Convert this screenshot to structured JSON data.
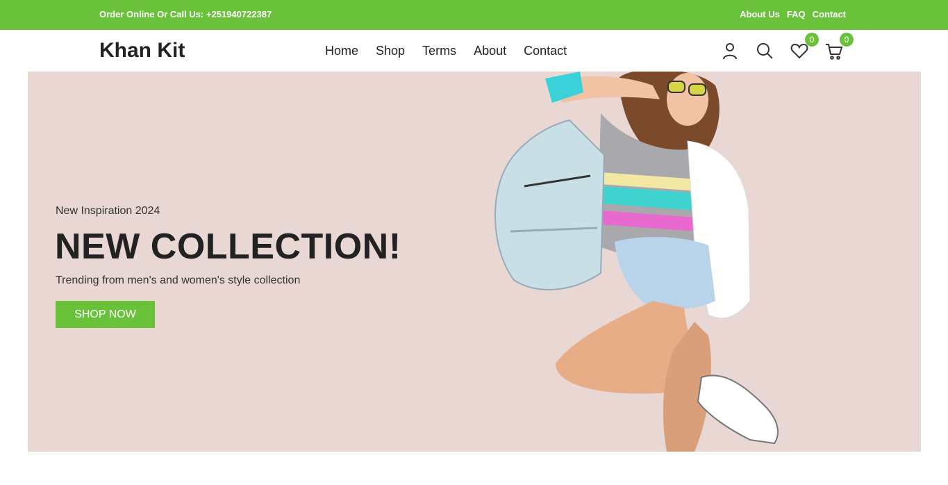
{
  "topbar": {
    "phone_text": "Order Online Or Call Us: +251940722387",
    "links": [
      "About Us",
      "FAQ",
      "Contact"
    ]
  },
  "header": {
    "logo": "Khan Kit",
    "nav": [
      "Home",
      "Shop",
      "Terms",
      "About",
      "Contact"
    ],
    "icons": [
      "user-icon",
      "search-icon",
      "heart-icon",
      "cart-icon"
    ],
    "wishlist_count": "0",
    "cart_count": "0"
  },
  "hero": {
    "kicker": "New Inspiration 2024",
    "headline": "NEW COLLECTION!",
    "subtitle": "Trending from men's and women's style collection",
    "cta_label": "SHOP NOW",
    "background_color": "#e8d7d3",
    "accent_color": "#6ac23b"
  }
}
